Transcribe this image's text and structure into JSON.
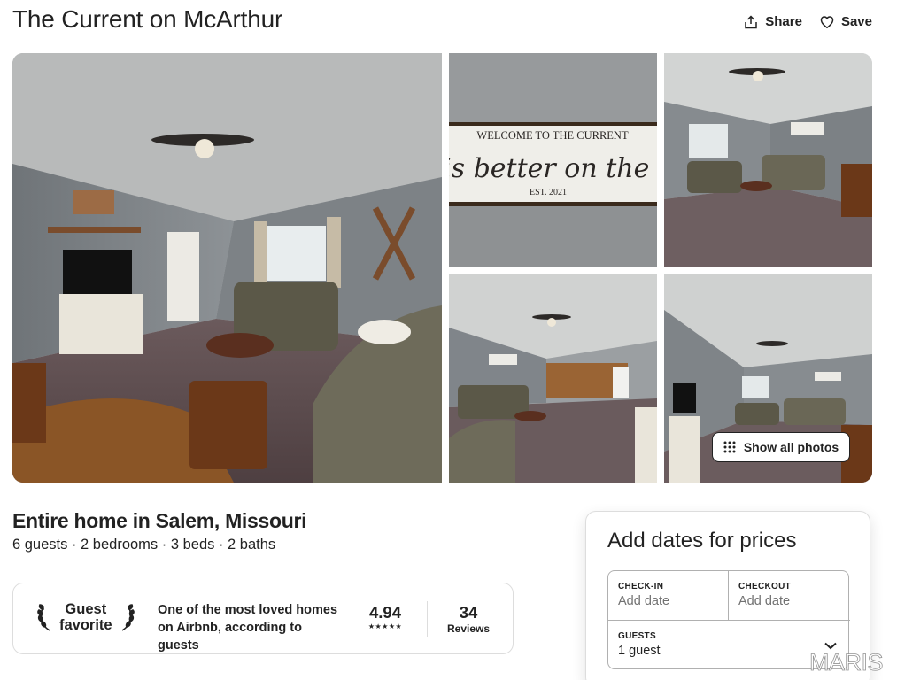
{
  "listing": {
    "title": "The Current on McArthur",
    "share_label": "Share",
    "save_label": "Save"
  },
  "gallery": {
    "sign_line1": "WELCOME TO THE CURRENT",
    "sign_line2": "Life is better on the river",
    "sign_line3": "EST. 2021",
    "show_all_label": "Show all photos"
  },
  "overview": {
    "subtitle": "Entire home in Salem, Missouri",
    "facts": "6 guests · 2 bedrooms · 3 beds · 2 baths"
  },
  "guest_favorite": {
    "badge_line1": "Guest",
    "badge_line2": "favorite",
    "description": "One of the most loved homes on Airbnb, according to guests",
    "rating": "4.94",
    "stars": "★★★★★",
    "reviews_count": "34",
    "reviews_label": "Reviews"
  },
  "booking": {
    "title": "Add dates for prices",
    "checkin_label": "CHECK-IN",
    "checkin_value": "Add date",
    "checkout_label": "CHECKOUT",
    "checkout_value": "Add date",
    "guests_label": "GUESTS",
    "guests_value": "1 guest"
  },
  "watermark": "MARIS",
  "icons": [
    "share-icon",
    "heart-icon",
    "grid-dots-icon",
    "laurel-left-icon",
    "laurel-right-icon",
    "chevron-down-icon"
  ]
}
